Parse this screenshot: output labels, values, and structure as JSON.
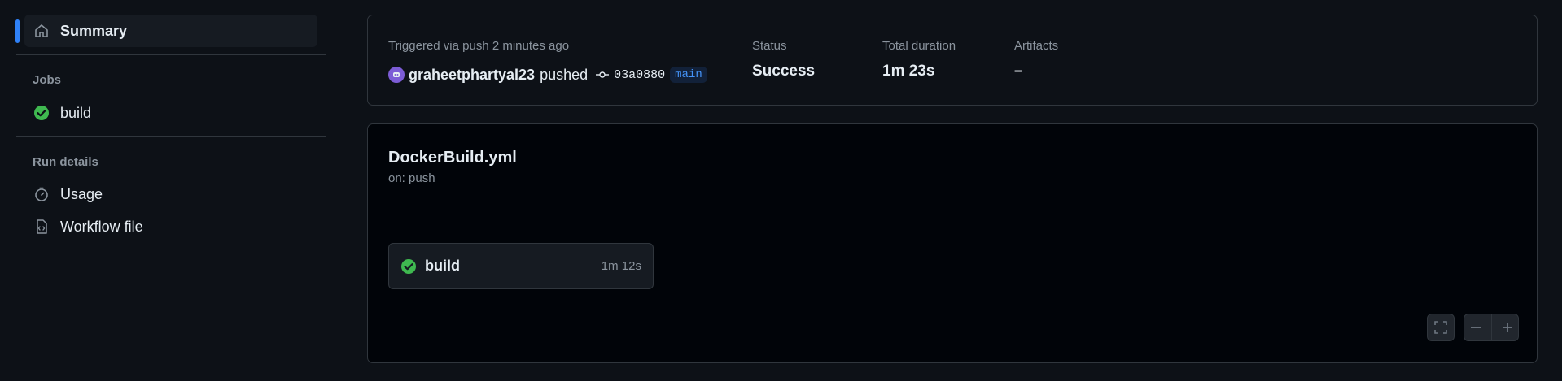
{
  "sidebar": {
    "summary_label": "Summary",
    "jobs_title": "Jobs",
    "jobs": [
      {
        "label": "build",
        "status": "success"
      }
    ],
    "run_details_title": "Run details",
    "usage_label": "Usage",
    "workflow_file_label": "Workflow file"
  },
  "summary": {
    "trigger_text": "Triggered via push 2 minutes ago",
    "actor": "graheetphartyal23",
    "action": "pushed",
    "commit_sha": "03a0880",
    "branch": "main",
    "status_label": "Status",
    "status_value": "Success",
    "duration_label": "Total duration",
    "duration_value": "1m 23s",
    "artifacts_label": "Artifacts",
    "artifacts_value": "–"
  },
  "workflow": {
    "file_name": "DockerBuild.yml",
    "trigger": "on: push",
    "job": {
      "name": "build",
      "duration": "1m 12s",
      "status": "success"
    }
  },
  "colors": {
    "success": "#3fb950",
    "accent": "#2f81f7",
    "branch": "#4493f8"
  }
}
